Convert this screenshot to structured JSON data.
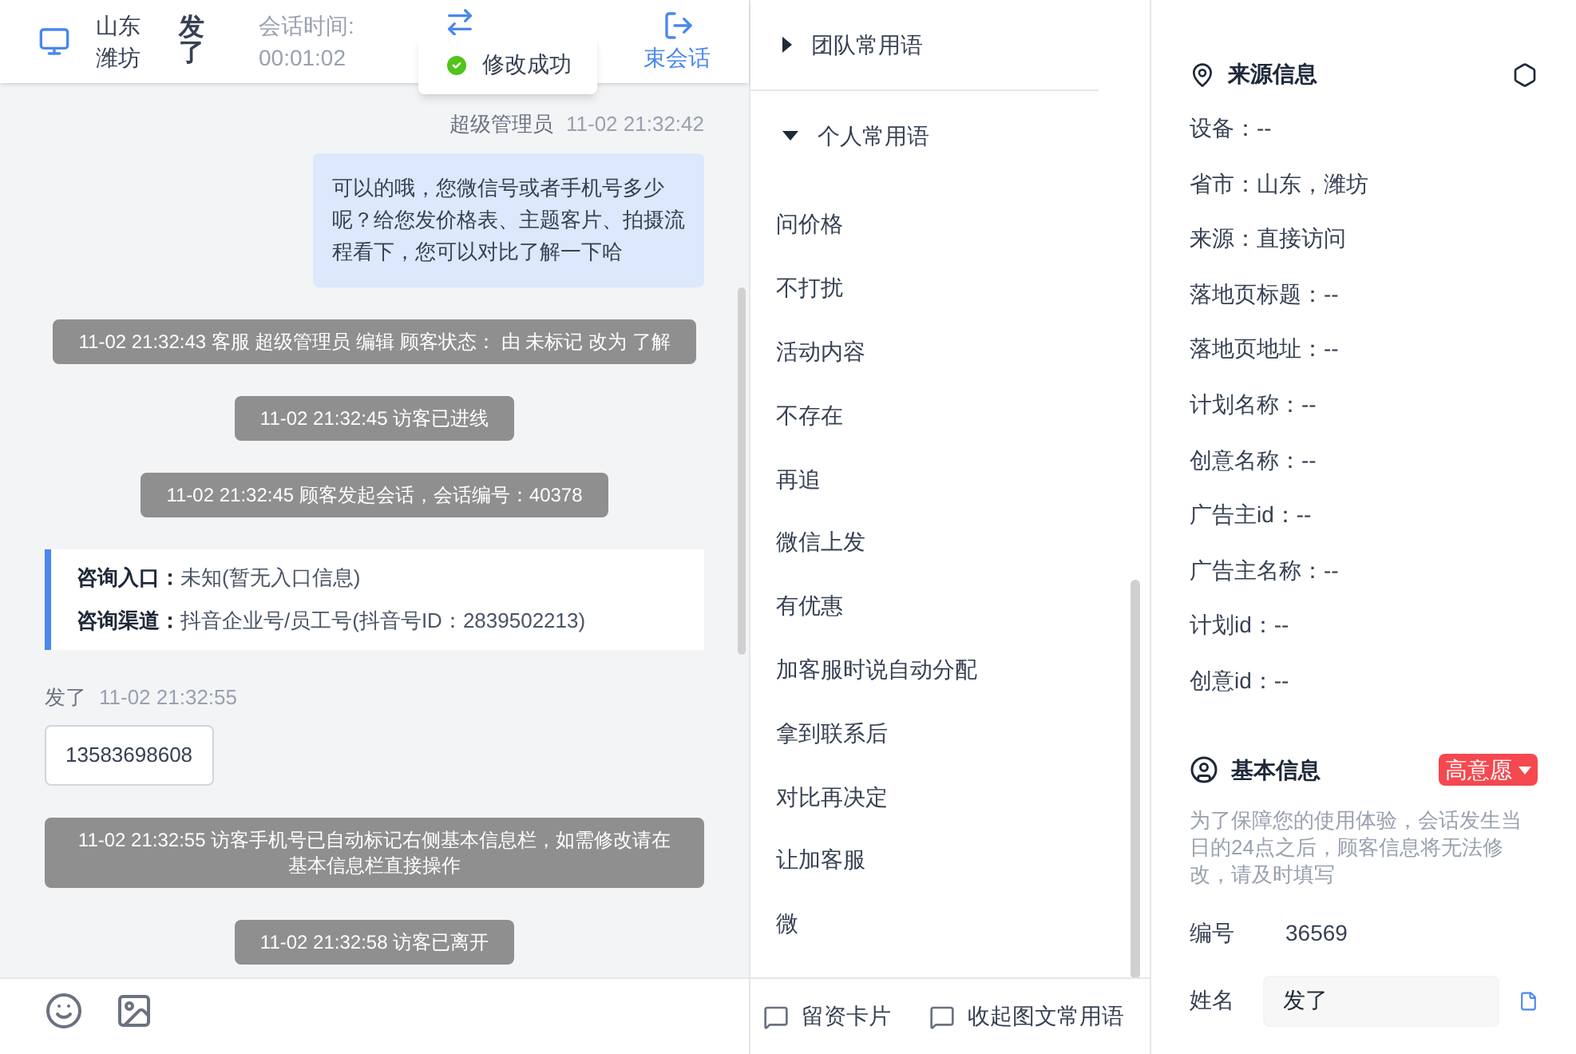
{
  "header": {
    "location": "山东潍坊",
    "visitor": "发了",
    "timer_label": "会话时间:",
    "timer": "00:01:02",
    "end_label": "束会话"
  },
  "toast": {
    "text": "修改成功"
  },
  "messages": [
    {
      "kind": "agent",
      "sender": "超级管理员",
      "time": "11-02 21:32:42",
      "text": "可以的哦，您微信号或者手机号多少呢？给您发价格表、主题客片、拍摄流程看下，您可以对比了解一下哈"
    },
    {
      "kind": "system",
      "text": "11-02 21:32:43 客服 超级管理员 编辑 顾客状态： 由 未标记 改为 了解"
    },
    {
      "kind": "system",
      "text": "11-02 21:32:45 访客已进线"
    },
    {
      "kind": "system",
      "text": "11-02 21:32:45 顾客发起会话，会话编号：40378"
    },
    {
      "kind": "info",
      "rows": [
        {
          "label": "咨询入口：",
          "value": "未知(暂无入口信息)"
        },
        {
          "label": "咨询渠道：",
          "value": "抖音企业号/员工号(抖音号ID：2839502213)"
        }
      ]
    },
    {
      "kind": "visitor",
      "sender": "发了",
      "time": "11-02 21:32:55",
      "text": "13583698608"
    },
    {
      "kind": "system",
      "text": "11-02 21:32:55 访客手机号已自动标记右侧基本信息栏，如需修改请在基本信息栏直接操作"
    },
    {
      "kind": "system",
      "text": "11-02 21:32:58 访客已离开"
    }
  ],
  "phrases": {
    "groups": [
      {
        "title": "团队常用语",
        "expanded": false
      },
      {
        "title": "个人常用语",
        "expanded": true,
        "items": [
          "问价格",
          "不打扰",
          "活动内容",
          "不存在",
          "再追",
          "微信上发",
          "有优惠",
          "加客服时说自动分配",
          "拿到联系后",
          "对比再决定",
          "让加客服",
          "微"
        ]
      }
    ],
    "actions": [
      "留资卡片",
      "收起图文常用语"
    ]
  },
  "source": {
    "title": "来源信息",
    "fields": [
      "设备：--",
      "省市：山东，潍坊",
      "来源：直接访问",
      "落地页标题：--",
      "落地页地址：--",
      "计划名称：--",
      "创意名称：--",
      "广告主id：--",
      "广告主名称：--",
      "计划id：--",
      "创意id：--"
    ]
  },
  "basic": {
    "title": "基本信息",
    "tag": {
      "label": "高意愿",
      "color": "#f5484f"
    },
    "notice": "为了保障您的使用体验，会话发生当日的24点之后，顾客信息将无法修改，请及时填写",
    "id_label": "编号",
    "id_value": "36569",
    "name_label": "姓名",
    "name_value": "发了"
  }
}
